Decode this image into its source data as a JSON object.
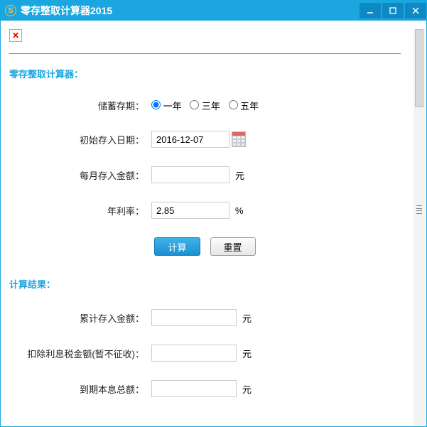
{
  "window": {
    "title": "零存整取计算器2015"
  },
  "form": {
    "section_title": "零存整取计算器：",
    "deposit_term": {
      "label": "储蓄存期：",
      "options": [
        "一年",
        "三年",
        "五年"
      ],
      "selected": "一年"
    },
    "start_date": {
      "label": "初始存入日期：",
      "value": "2016-12-07"
    },
    "monthly_deposit": {
      "label": "每月存入金额：",
      "value": "",
      "unit": "元"
    },
    "annual_rate": {
      "label": "年利率：",
      "value": "2.85",
      "unit": "%"
    },
    "buttons": {
      "calc": "计算",
      "reset": "重置"
    }
  },
  "result": {
    "section_title": "计算结果：",
    "total_deposit": {
      "label": "累计存入金额：",
      "value": "",
      "unit": "元"
    },
    "tax_deducted": {
      "label": "扣除利息税金额(暂不征收)：",
      "value": "",
      "unit": "元"
    },
    "final_total": {
      "label": "到期本息总额：",
      "value": "",
      "unit": "元"
    }
  }
}
